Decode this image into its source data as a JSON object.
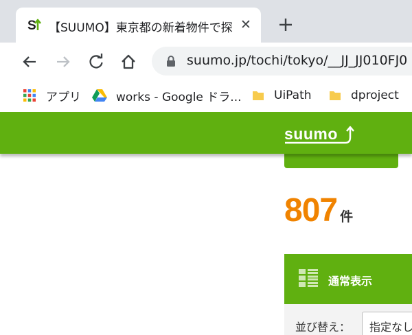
{
  "browser": {
    "tab": {
      "title": "【SUUMO】東京都の新着物件で探",
      "close_glyph": "✕"
    },
    "address": {
      "url": "suumo.jp/tochi/tokyo/__JJ_JJ010FJ0"
    },
    "bookmarks": [
      {
        "label": "アプリ",
        "icon": "apps-grid-icon"
      },
      {
        "label": "works - Google ドラ...",
        "icon": "google-drive-icon"
      },
      {
        "label": "UiPath",
        "icon": "folder-icon"
      },
      {
        "label": "dproject",
        "icon": "folder-icon"
      }
    ]
  },
  "page": {
    "brand": "suumo",
    "result": {
      "count": "807",
      "unit": "件"
    },
    "view": {
      "label": "通常表示"
    },
    "sort": {
      "label": "並び替え：",
      "value": "指定なし"
    }
  },
  "colors": {
    "brand_green": "#60b010",
    "count_orange": "#f08300",
    "tabstrip_bg": "#dee1e6",
    "omnibox_bg": "#f1f3f4"
  }
}
